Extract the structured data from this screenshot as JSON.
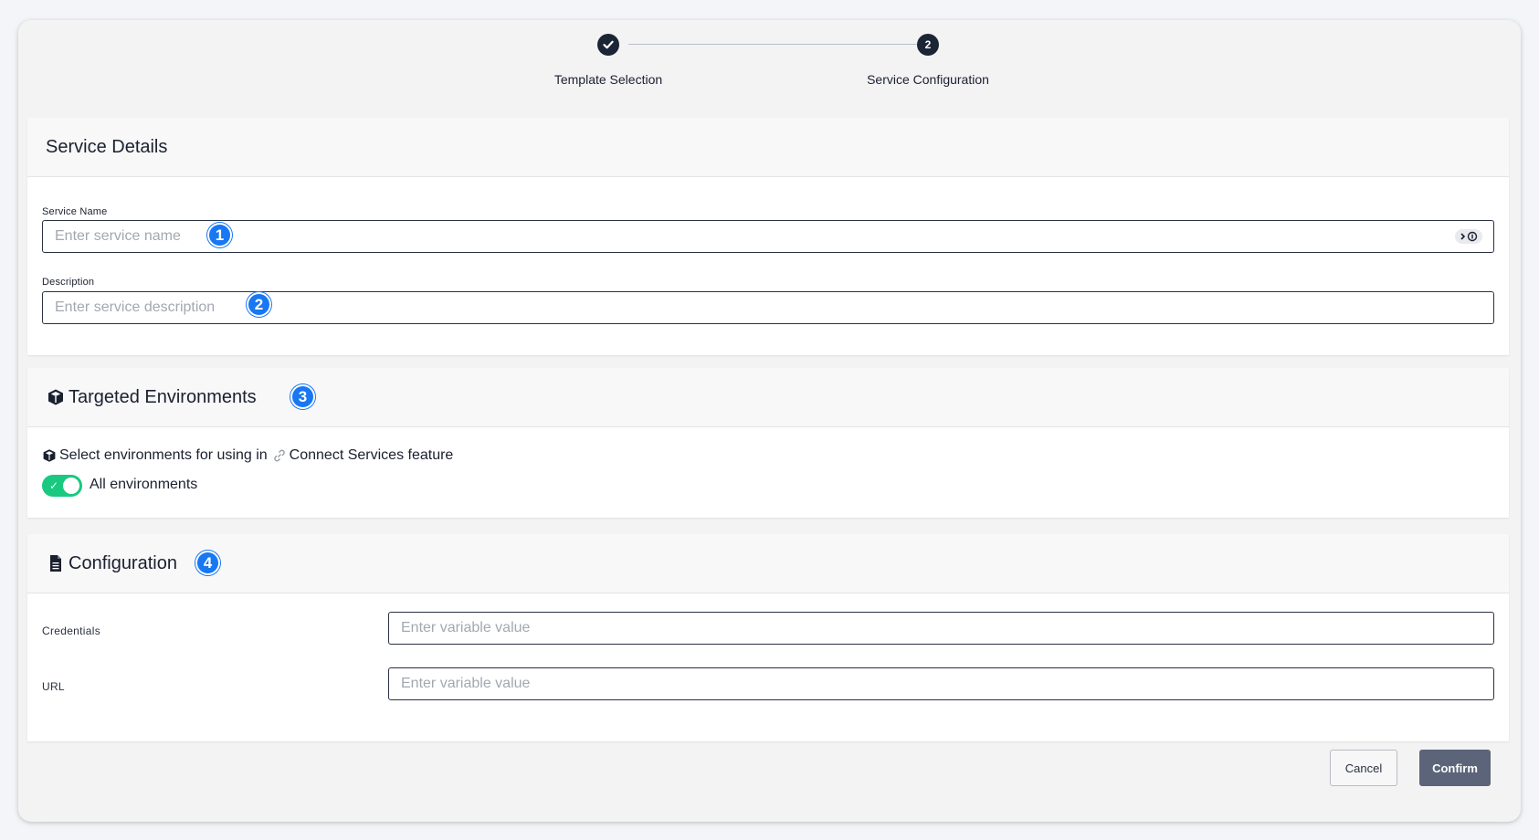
{
  "stepper": {
    "steps": [
      {
        "label": "Template Selection",
        "state": "done",
        "marker": "✓"
      },
      {
        "label": "Service Configuration",
        "state": "current",
        "marker": "2"
      }
    ]
  },
  "service_details": {
    "title": "Service Details",
    "name_label": "Service Name",
    "name_placeholder": "Enter service name",
    "name_badge": "1",
    "description_label": "Description",
    "description_placeholder": "Enter service description",
    "description_badge": "2"
  },
  "targeted_environments": {
    "title": "Targeted Environments",
    "badge": "3",
    "select_text": "Select environments for using in",
    "feature_text": "Connect Services feature",
    "toggle_label": "All environments",
    "toggle_on": true
  },
  "configuration": {
    "title": "Configuration",
    "badge": "4",
    "rows": [
      {
        "label": "Credentials",
        "placeholder": "Enter variable value"
      },
      {
        "label": "URL",
        "placeholder": "Enter variable value"
      }
    ]
  },
  "footer": {
    "cancel_label": "Cancel",
    "confirm_label": "Confirm"
  },
  "colors": {
    "badge": "#1877f2",
    "toggle_on": "#18c97f",
    "confirm_bg": "#5b6478",
    "step_dot": "#1c2536"
  }
}
